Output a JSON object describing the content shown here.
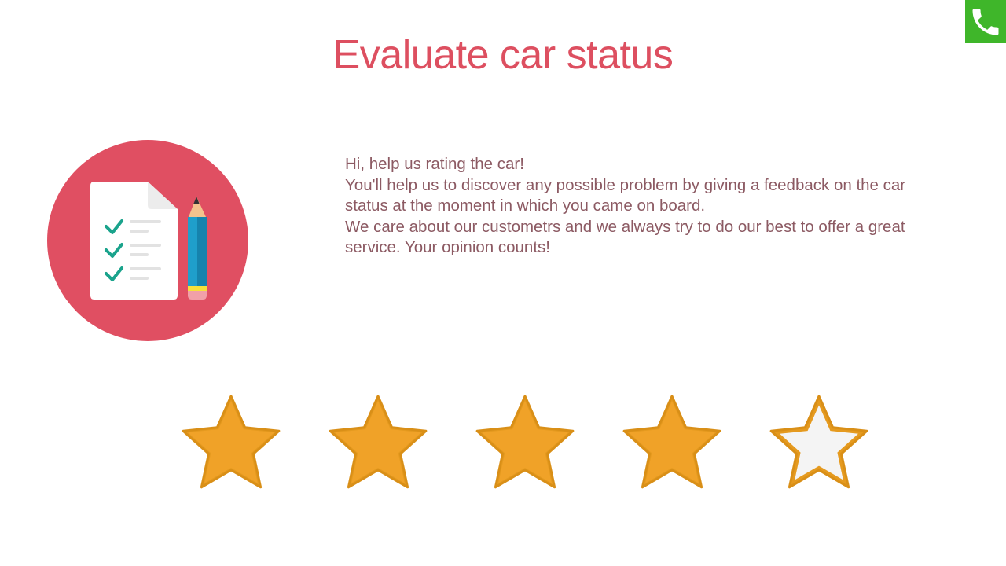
{
  "title": "Evaluate car status",
  "description": {
    "line1": "Hi, help us rating the car!",
    "line2": "You'll help us to discover any possible problem by giving a feedback on the car status at the moment in which you came on board.",
    "line3": "We care about our custometrs and we always try to do our best to offer a great service. Your opinion counts!"
  },
  "rating": {
    "value": 4,
    "max": 5
  },
  "icons": {
    "call": "phone-icon",
    "hero": "checklist-icon"
  },
  "colors": {
    "title": "#dd4f60",
    "text": "#8c5a63",
    "hero_circle": "#e04f62",
    "star_fill": "#f0a228",
    "star_empty": "#f4f4f4",
    "call_button": "#3fb62a"
  }
}
